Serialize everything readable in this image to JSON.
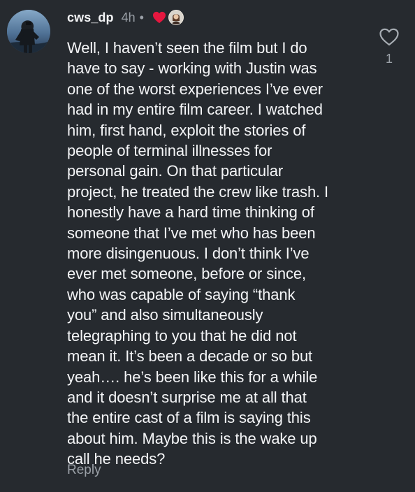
{
  "comment": {
    "username": "cws_dp",
    "time": "4h",
    "separator": "•",
    "text": "Well, I haven’t seen the film but I do\nhave to say - working with Justin was\none of the worst experiences I’ve ever\nhad in my entire film career. I watched\nhim, first hand, exploit the stories of\npeople of terminal illnesses for\npersonal gain. On that particular\nproject, he treated the crew like trash. I\nhonestly have a hard time thinking of\nsomeone that I’ve met who has been\nmore disingenuous. I don’t think I’ve\never met someone, before or since,\nwho was capable of saying “thank\nyou” and also simultaneously\ntelegraphing to you that he did not\nmean it. It’s been a decade or so but\nyeah…. he’s been like this for a while\nand it doesn’t surprise me at all that\nthe entire cast of a film is saying this\nabout him. Maybe this is the wake up\ncall he needs?",
    "like_count": "1",
    "reply_label": "Reply"
  },
  "icons": {
    "avatar": "user-avatar",
    "creator_heart": "heart-icon",
    "creator_avatar": "creator-avatar",
    "like": "heart-outline-icon"
  },
  "colors": {
    "background": "#262a2f",
    "text": "#f4f5f7",
    "secondary_text": "#9aa0a7",
    "creator_heart": "#e5173f"
  }
}
